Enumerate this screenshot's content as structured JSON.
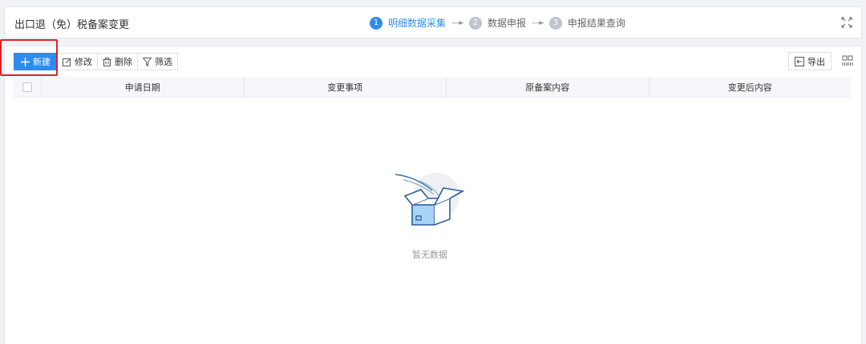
{
  "header": {
    "title": "出口退（免）税备案变更",
    "steps": [
      {
        "num": "1",
        "label": "明细数据采集"
      },
      {
        "num": "2",
        "label": "数据申报"
      },
      {
        "num": "3",
        "label": "申报结果查询"
      }
    ],
    "arrow": "----►",
    "expand_icon": "expand-icon"
  },
  "toolbar": {
    "new_label": "新建",
    "edit_label": "修改",
    "delete_label": "删除",
    "filter_label": "筛选",
    "export_label": "导出"
  },
  "table": {
    "columns": [
      "申请日期",
      "变更事项",
      "原备案内容",
      "变更后内容"
    ],
    "rows": []
  },
  "empty_state": {
    "text": "暂无数据"
  },
  "colors": {
    "primary": "#2d8cf0",
    "highlight": "#e02020"
  }
}
